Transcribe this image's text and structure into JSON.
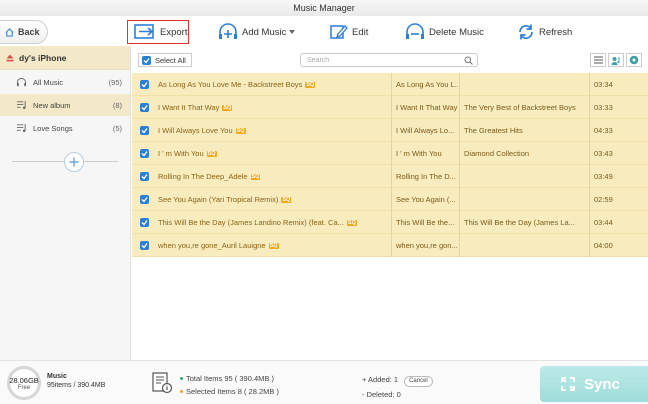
{
  "window": {
    "title": "Music Manager"
  },
  "toolbar": {
    "back_label": "Back",
    "export_label": "Export",
    "add_label": "Add Music",
    "edit_label": "Edit",
    "delete_label": "Delete Music",
    "refresh_label": "Refresh"
  },
  "sidebar": {
    "device_name": "dy's iPhone",
    "items": [
      {
        "label": "All Music",
        "count": "(95)",
        "icon": "headphones-icon"
      },
      {
        "label": "New album",
        "count": "(8)",
        "icon": "playlist-icon"
      },
      {
        "label": "Love Songs",
        "count": "(5)",
        "icon": "playlist-icon"
      }
    ]
  },
  "list": {
    "select_all_label": "Select All",
    "search_placeholder": "Search",
    "quality_badge": "SQ",
    "rows": [
      {
        "title": "As Long As You Love Me - Backstreet Boys",
        "sq": true,
        "artist": "As Long As You L...",
        "album": "",
        "duration": "03:34"
      },
      {
        "title": "I Want It That Way",
        "sq": true,
        "artist": "I Want It That Way",
        "album": "The Very Best of Backstreet Boys",
        "duration": "03:33"
      },
      {
        "title": "I Will Always Love You",
        "sq": true,
        "artist": "I Will Always Lo...",
        "album": "The Greatest Hits",
        "duration": "04:33"
      },
      {
        "title": "I ' m With You",
        "sq": true,
        "artist": "I ' m With You",
        "album": "Diamond Collection",
        "duration": "03:43"
      },
      {
        "title": "Rolling In The Deep_Adele",
        "sq": true,
        "artist": "Rolling In The D...",
        "album": "",
        "duration": "03:49"
      },
      {
        "title": "See You Again (Yari Tropical Remix)",
        "sq": true,
        "artist": "See You Again (...",
        "album": "",
        "duration": "02:59"
      },
      {
        "title": "This Will Be the Day (James Landino Remix) (feat. Ca...",
        "sq": true,
        "artist": "This Will Be the...",
        "album": "This Will Be the Day (James La...",
        "duration": "03:44"
      },
      {
        "title": "when you,re gone_Auril Lauigne",
        "sq": true,
        "artist": "when you,re gon...",
        "album": "",
        "duration": "04:00"
      }
    ]
  },
  "footer": {
    "storage_free": "28.06GB",
    "storage_free_label": "Free",
    "music_heading": "Music",
    "music_summary": "95items / 390.4MB",
    "total_items": "Total Items 95 ( 390.4MB )",
    "selected_items": "Selected Items 8 ( 28.2MB )",
    "added": "+ Added: 1",
    "cancel_label": "Cancel",
    "deleted": "- Deleted: 0",
    "sync_label": "Sync"
  },
  "colors": {
    "row_highlight": "#f8ecbf",
    "checkbox_blue": "#2d7fd6",
    "export_border": "#e0332e",
    "sq_badge": "#f0a91c",
    "sync_button": "#a8e0dd"
  }
}
